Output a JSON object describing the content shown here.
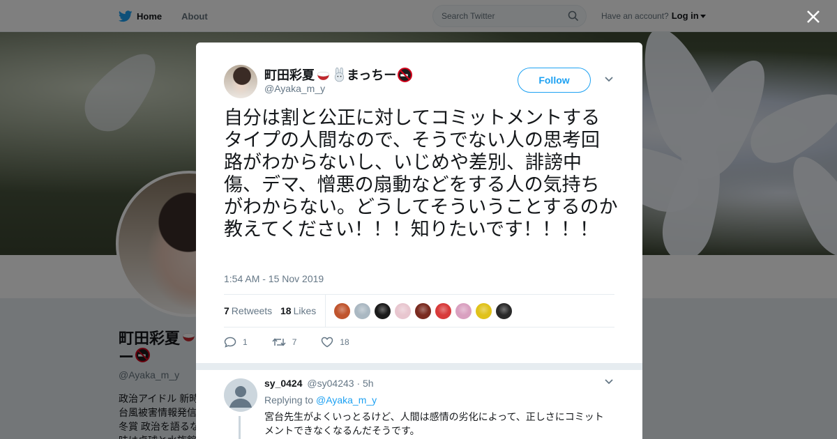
{
  "nav": {
    "home_label": "Home",
    "about_label": "About",
    "search_placeholder": "Search Twitter",
    "have_account": "Have an account?",
    "login_label": "Log in"
  },
  "profile": {
    "name_line1": "町田彩夏",
    "name_line2": "ー",
    "handle": "@Ayaka_m_y",
    "bio_lines": [
      "政治アイドル 新時",
      "台風被害情報発信",
      "冬賞 政治を語るな",
      "味は卓球と水族館"
    ]
  },
  "tweet": {
    "display_name": "町田彩夏",
    "display_name_suffix": "まっちー",
    "handle": "@Ayaka_m_y",
    "follow_label": "Follow",
    "text": "自分は割と公正に対してコミットメントするタイプの人間なので、そうでない人の思考回路がわからないし、いじめや差別、誹謗中傷、デマ、憎悪の扇動などをする人の気持ちがわからない。どうしてそういうことするのか教えてください！！！知りたいです！！！！",
    "timestamp": "1:54 AM - 15 Nov 2019",
    "retweets_count": "7",
    "retweets_label": "Retweets",
    "likes_count": "18",
    "likes_label": "Likes",
    "reply_action_count": "1",
    "retweet_action_count": "7",
    "like_action_count": "18",
    "liker_colors": [
      "#c0552e",
      "#aab8c2",
      "#1b1b1b",
      "#e8c6cf",
      "#7a2b20",
      "#d83a3a",
      "#d9a0c0",
      "#e0c21a",
      "#2a2a2a"
    ]
  },
  "reply": {
    "name": "sy_0424",
    "handle": "@sy04243",
    "time": "· 5h",
    "replying_to_label": "Replying to",
    "replying_to_handle": "@Ayaka_m_y",
    "text": "宮台先生がよくいっとるけど、人間は感情の劣化によって、正しさにコミットメントできなくなるんだそうです。"
  },
  "colors": {
    "accent": "#1da1f2",
    "text": "#14171a",
    "muted": "#657786"
  }
}
